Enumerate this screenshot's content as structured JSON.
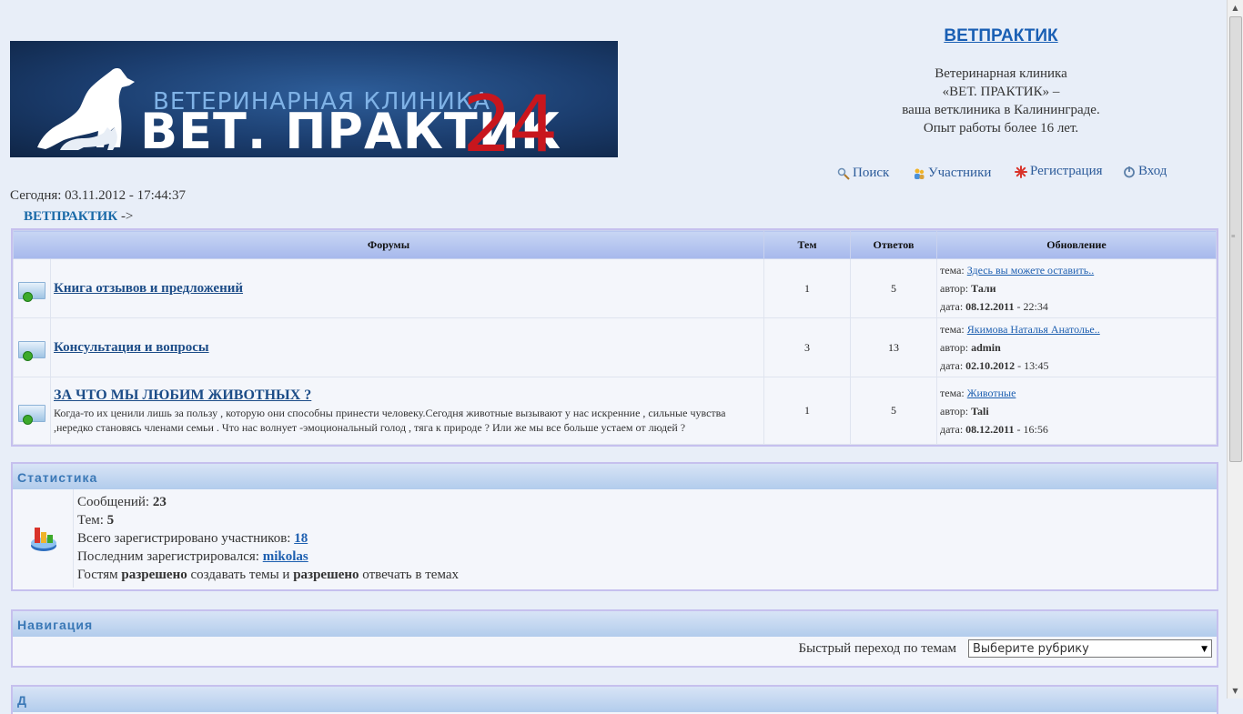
{
  "banner": {
    "line1": "ВЕТЕРИНАРНАЯ КЛИНИКА",
    "line2": "ВЕТ. ПРАКТИК",
    "number": "24"
  },
  "site": {
    "title": "ВЕТПРАКТИК",
    "desc": [
      "Ветеринарная клиника",
      "«ВЕТ. ПРАКТИК» –",
      "ваша ветклиника в Калининграде.",
      "Опыт работы более 16 лет."
    ]
  },
  "topnav": {
    "search": "Поиск",
    "members": "Участники",
    "register": "Регистрация",
    "login": "Вход"
  },
  "today": "Сегодня: 03.11.2012 - 17:44:37",
  "breadcrumb": {
    "home": "ВЕТПРАКТИК",
    "sep": " ->"
  },
  "forums": {
    "headers": {
      "forums": "Форумы",
      "topics": "Тем",
      "replies": "Ответов",
      "updated": "Обновление"
    },
    "labels": {
      "topic": "тема: ",
      "author": "автор: ",
      "date": "дата: "
    },
    "rows": [
      {
        "title": "Книга отзывов и предложений",
        "desc": "",
        "topics": "1",
        "replies": "5",
        "last_topic": "Здесь вы можете оставить..",
        "last_author": "Тали",
        "last_date": "08.12.2011",
        "last_time": " - 22:34"
      },
      {
        "title": "Консультация и вопросы",
        "desc": "",
        "topics": "3",
        "replies": "13",
        "last_topic": "Якимова Наталья Анатолье..",
        "last_author": "admin",
        "last_date": "02.10.2012",
        "last_time": " - 13:45"
      },
      {
        "title": "ЗА ЧТО МЫ ЛЮБИМ ЖИВОТНЫХ ?",
        "desc": "Когда-то их ценили лишь за пользу , которую они способны принести человеку.Сегодня животные вызывают у нас искренние , сильные чувства ,нередко становясь членами семьи . Что нас волнует -эмоциональный голод , тяга к природе ? Или же мы все больше устаем от людей ?",
        "topics": "1",
        "replies": "5",
        "last_topic": "Животные",
        "last_author": "Tali",
        "last_date": "08.12.2011",
        "last_time": " - 16:56"
      }
    ]
  },
  "stats": {
    "title": "Статистика",
    "messages_label": "Сообщений: ",
    "messages": "23",
    "topics_label": "Тем: ",
    "topics": "5",
    "members_label": "Всего зарегистрировано участников: ",
    "members": "18",
    "last_label": "Последним зарегистрировался: ",
    "last_user": "mikolas",
    "guests_1": "Гостям ",
    "guests_allowed1": "разрешено",
    "guests_2": " создавать темы и ",
    "guests_allowed2": "разрешено",
    "guests_3": " отвечать в темах"
  },
  "navigation": {
    "title": "Навигация",
    "quick_jump_label": "Быстрый переход по темам",
    "select_value": "Выберите рубрику"
  },
  "next_section": {
    "title": "Д"
  }
}
